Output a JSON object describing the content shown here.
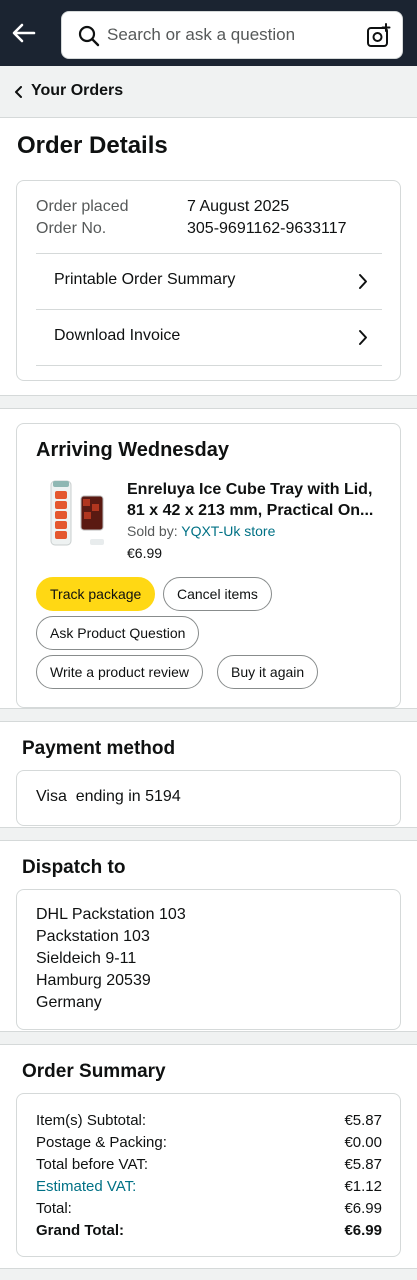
{
  "search": {
    "placeholder": "Search or ask a question"
  },
  "icons": {
    "back": "back-arrow-icon",
    "search": "search-icon",
    "camera": "camera-lens-icon",
    "chevron": "chevron-right-icon",
    "crumb": "chevron-left-icon"
  },
  "breadcrumb": {
    "label": "Your Orders"
  },
  "page_title": "Order Details",
  "order_info": {
    "placed_label": "Order placed",
    "placed_value": "7 August 2025",
    "number_label": "Order No.",
    "number_value": "305-9691162-9633117",
    "links": [
      "Printable Order Summary",
      "Download Invoice"
    ]
  },
  "shipment": {
    "title": "Arriving Wednesday",
    "product_title_line1": "Enreluya Ice Cube Tray with Lid,",
    "product_title_line2": "81 x 42 x 213 mm, Practical On...",
    "sold_by_label": "Sold by:",
    "seller": "YQXT-Uk store",
    "price": "€6.99",
    "buttons": {
      "track": "Track package",
      "cancel": "Cancel items",
      "ask": "Ask Product Question",
      "review": "Write a product review",
      "buy_again": "Buy it again"
    }
  },
  "payment": {
    "title": "Payment method",
    "method": "Visa  ending in 5194"
  },
  "dispatch": {
    "title": "Dispatch to",
    "lines": [
      "DHL Packstation 103",
      "Packstation 103",
      "Sieldeich 9-11",
      "Hamburg 20539",
      "Germany"
    ]
  },
  "summary": {
    "title": "Order Summary",
    "rows": [
      {
        "label": "Item(s) Subtotal:",
        "value": "€5.87"
      },
      {
        "label": "Postage & Packing:",
        "value": "€0.00"
      },
      {
        "label": "Total before VAT:",
        "value": "€5.87"
      },
      {
        "label": "Estimated VAT:",
        "value": "€1.12"
      },
      {
        "label": "Total:",
        "value": "€6.99"
      },
      {
        "label": "Grand Total:",
        "value": "€6.99"
      }
    ]
  },
  "colors": {
    "topbar": "#1b2431",
    "link": "#007185",
    "button_yellow": "#ffd814",
    "divider_bg": "#f0f2f2"
  }
}
